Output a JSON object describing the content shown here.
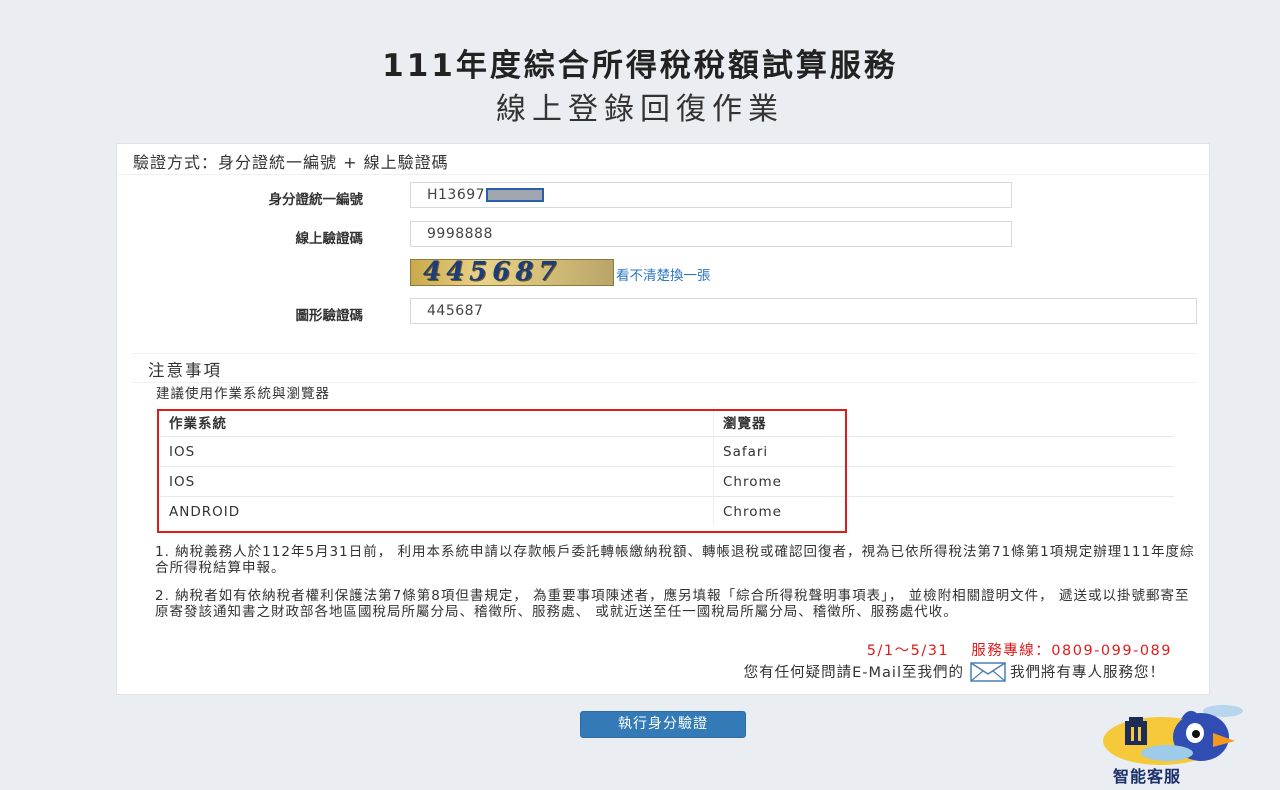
{
  "header": {
    "title": "111年度綜合所得稅稅額試算服務",
    "subtitle": "線上登錄回復作業"
  },
  "form": {
    "method_label": "驗證方式：身分證統一編號 + 線上驗證碼",
    "id_label": "身分證統一編號",
    "id_value": "H13697",
    "online_code_label": "線上驗證碼",
    "online_code_value": "9998888",
    "captcha_text": "445687",
    "refresh_link": "看不清楚換一張",
    "graphic_code_label": "圖形驗證碼",
    "graphic_code_value": "445687"
  },
  "notice": {
    "title": "注意事項",
    "recommend": "建議使用作業系統與瀏覽器",
    "table": {
      "headers": [
        "作業系統",
        "瀏覽器"
      ],
      "rows": [
        [
          "IOS",
          "Safari"
        ],
        [
          "IOS",
          "Chrome"
        ],
        [
          "ANDROID",
          "Chrome"
        ]
      ]
    },
    "para1": "1. 納稅義務人於112年5月31日前， 利用本系統申請以存款帳戶委託轉帳繳納稅額、轉帳退稅或確認回復者，視為已依所得稅法第71條第1項規定辦理111年度綜合所得稅結算申報。",
    "para2": "2. 納稅者如有依納稅者權利保護法第7條第8項但書規定， 為重要事項陳述者，應另填報「綜合所得稅聲明事項表」， 並檢附相關證明文件， 遞送或以掛號郵寄至原寄發該通知書之財政部各地區國稅局所屬分局、稽徵所、服務處、 或就近送至任一國稅局所屬分局、稽徵所、服務處代收。",
    "hotline": "5/1～5/31　 服務專線：0809-099-089",
    "contact_before": "您有任何疑問請E-Mail至我們的",
    "contact_after": "我們將有專人服務您！"
  },
  "actions": {
    "submit": "執行身分驗證"
  },
  "assistant": {
    "label": "智能客服"
  }
}
